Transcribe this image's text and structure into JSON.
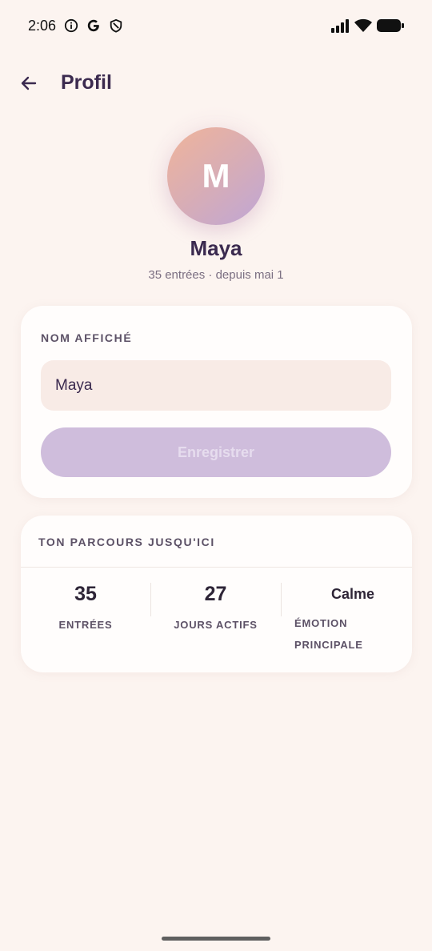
{
  "status_bar": {
    "time": "2:06",
    "icons": [
      "info-circle-icon",
      "google-g-icon",
      "shield-icon",
      "signal-icon",
      "wifi-icon",
      "battery-icon"
    ]
  },
  "app_bar": {
    "back_icon": "arrow-left-icon",
    "title": "Profil"
  },
  "profile": {
    "avatar_letter": "M",
    "name": "Maya",
    "meta": "35 entrées · depuis mai 1"
  },
  "name_card": {
    "section_label": "NOM AFFICHÉ",
    "input_value": "Maya",
    "save_label": "Enregistrer"
  },
  "stats_card": {
    "section_label": "TON PARCOURS JUSQU'ICI",
    "stats": [
      {
        "value": "35",
        "label": "ENTRÉES"
      },
      {
        "value": "27",
        "label": "JOURS ACTIFS"
      },
      {
        "value": "Calme",
        "label_line1": "ÉMOTION",
        "label_line2": "PRINCIPALE"
      }
    ]
  },
  "colors": {
    "background": "#fcf4f0",
    "card": "#fffdfc",
    "accent_text": "#3b2a4f",
    "button_disabled": "#cfbddc",
    "input_fill": "#f8ebe6"
  }
}
